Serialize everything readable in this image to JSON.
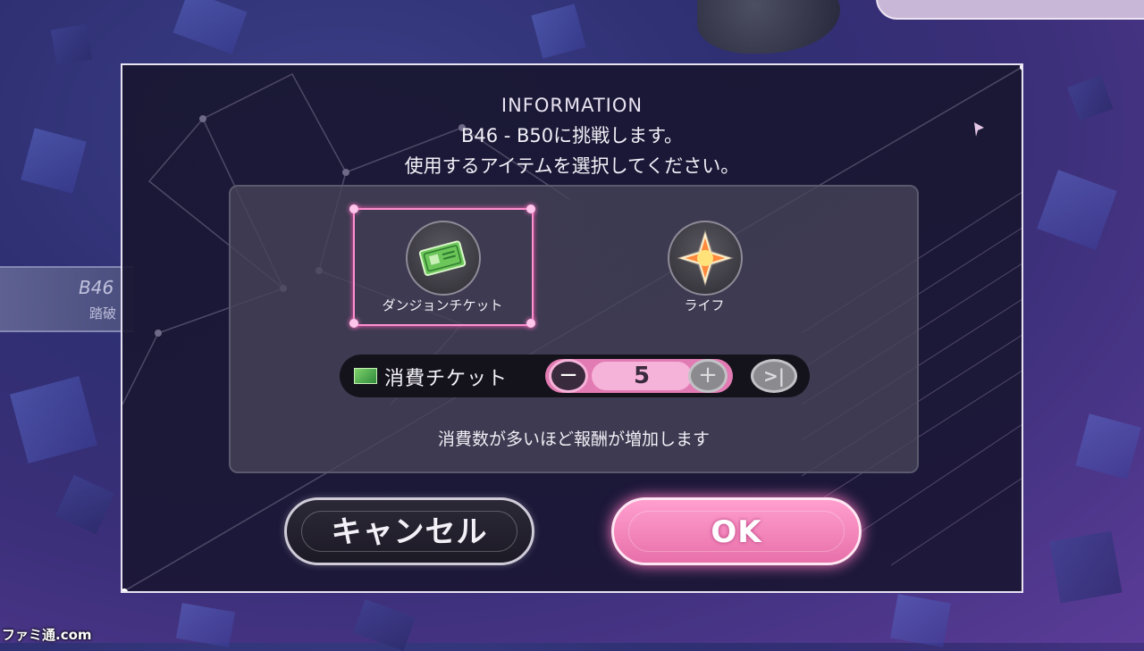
{
  "background": {
    "side_tab": {
      "code": "B46",
      "status": "踏破"
    }
  },
  "dialog": {
    "title": "INFORMATION",
    "message_line1": "B46 - B50に挑戦します。",
    "message_line2": "使用するアイテムを選択してください。",
    "items": [
      {
        "label": "ダンジョンチケット",
        "icon": "dungeon-ticket-icon",
        "selected": true
      },
      {
        "label": "ライフ",
        "icon": "life-star-icon",
        "selected": false
      }
    ],
    "ticket": {
      "label": "消費チケット",
      "quantity": "5",
      "minus_symbol": "−",
      "plus_symbol": "+",
      "max_symbol": ">|"
    },
    "hint": "消費数が多いほど報酬が増加します",
    "cancel_label": "キャンセル",
    "ok_label": "OK"
  },
  "watermark": "ファミ通.com",
  "colors": {
    "accent_pink": "#ff8fd0",
    "ok_button": "#e870aa",
    "dialog_bg": "#181630"
  }
}
